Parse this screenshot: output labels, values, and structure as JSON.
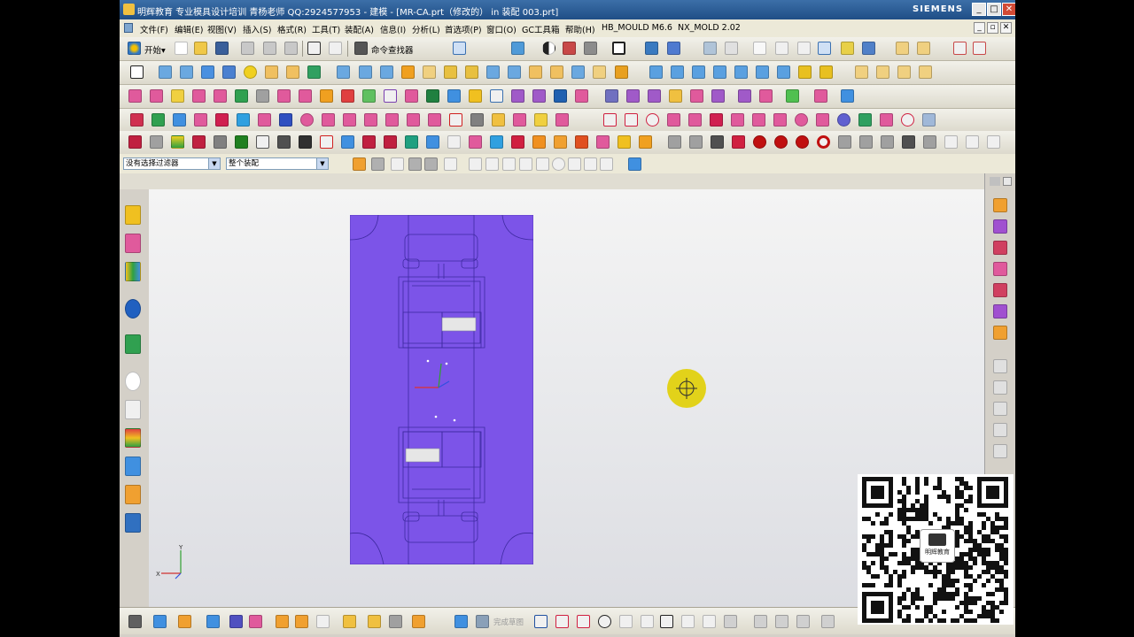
{
  "window": {
    "title": "明辉教育 专业模具设计培训 青杨老师  QQ:2924577953 - 建模 - [MR-CA.prt（修改的） in 装配 003.prt]",
    "brand": "SIEMENS",
    "controls": {
      "minimize": "_",
      "maximize": "□",
      "close": "✕"
    }
  },
  "menu": {
    "items": [
      "文件(F)",
      "编辑(E)",
      "视图(V)",
      "插入(S)",
      "格式(R)",
      "工具(T)",
      "装配(A)",
      "信息(I)",
      "分析(L)",
      "首选项(P)",
      "窗口(O)",
      "GC工具箱",
      "帮助(H)",
      "HB_MOULD M6.6",
      "NX_MOLD 2.02"
    ]
  },
  "toolbar": {
    "start_label": "开始▾",
    "command_finder_label": "命令查找器"
  },
  "filter": {
    "selection_filter": "没有选择过滤器",
    "scope": "整个装配"
  },
  "bottom_toolbar": {
    "sketch_label": "完成草图"
  },
  "viewport": {
    "part_color": "#7c54e8",
    "cursor_color": "#e2d21a",
    "background_color": "#e9e9ec",
    "triad_labels": {
      "y": "Y",
      "x": "X"
    }
  },
  "qr_panel": {
    "logo_text": "明辉教育"
  }
}
